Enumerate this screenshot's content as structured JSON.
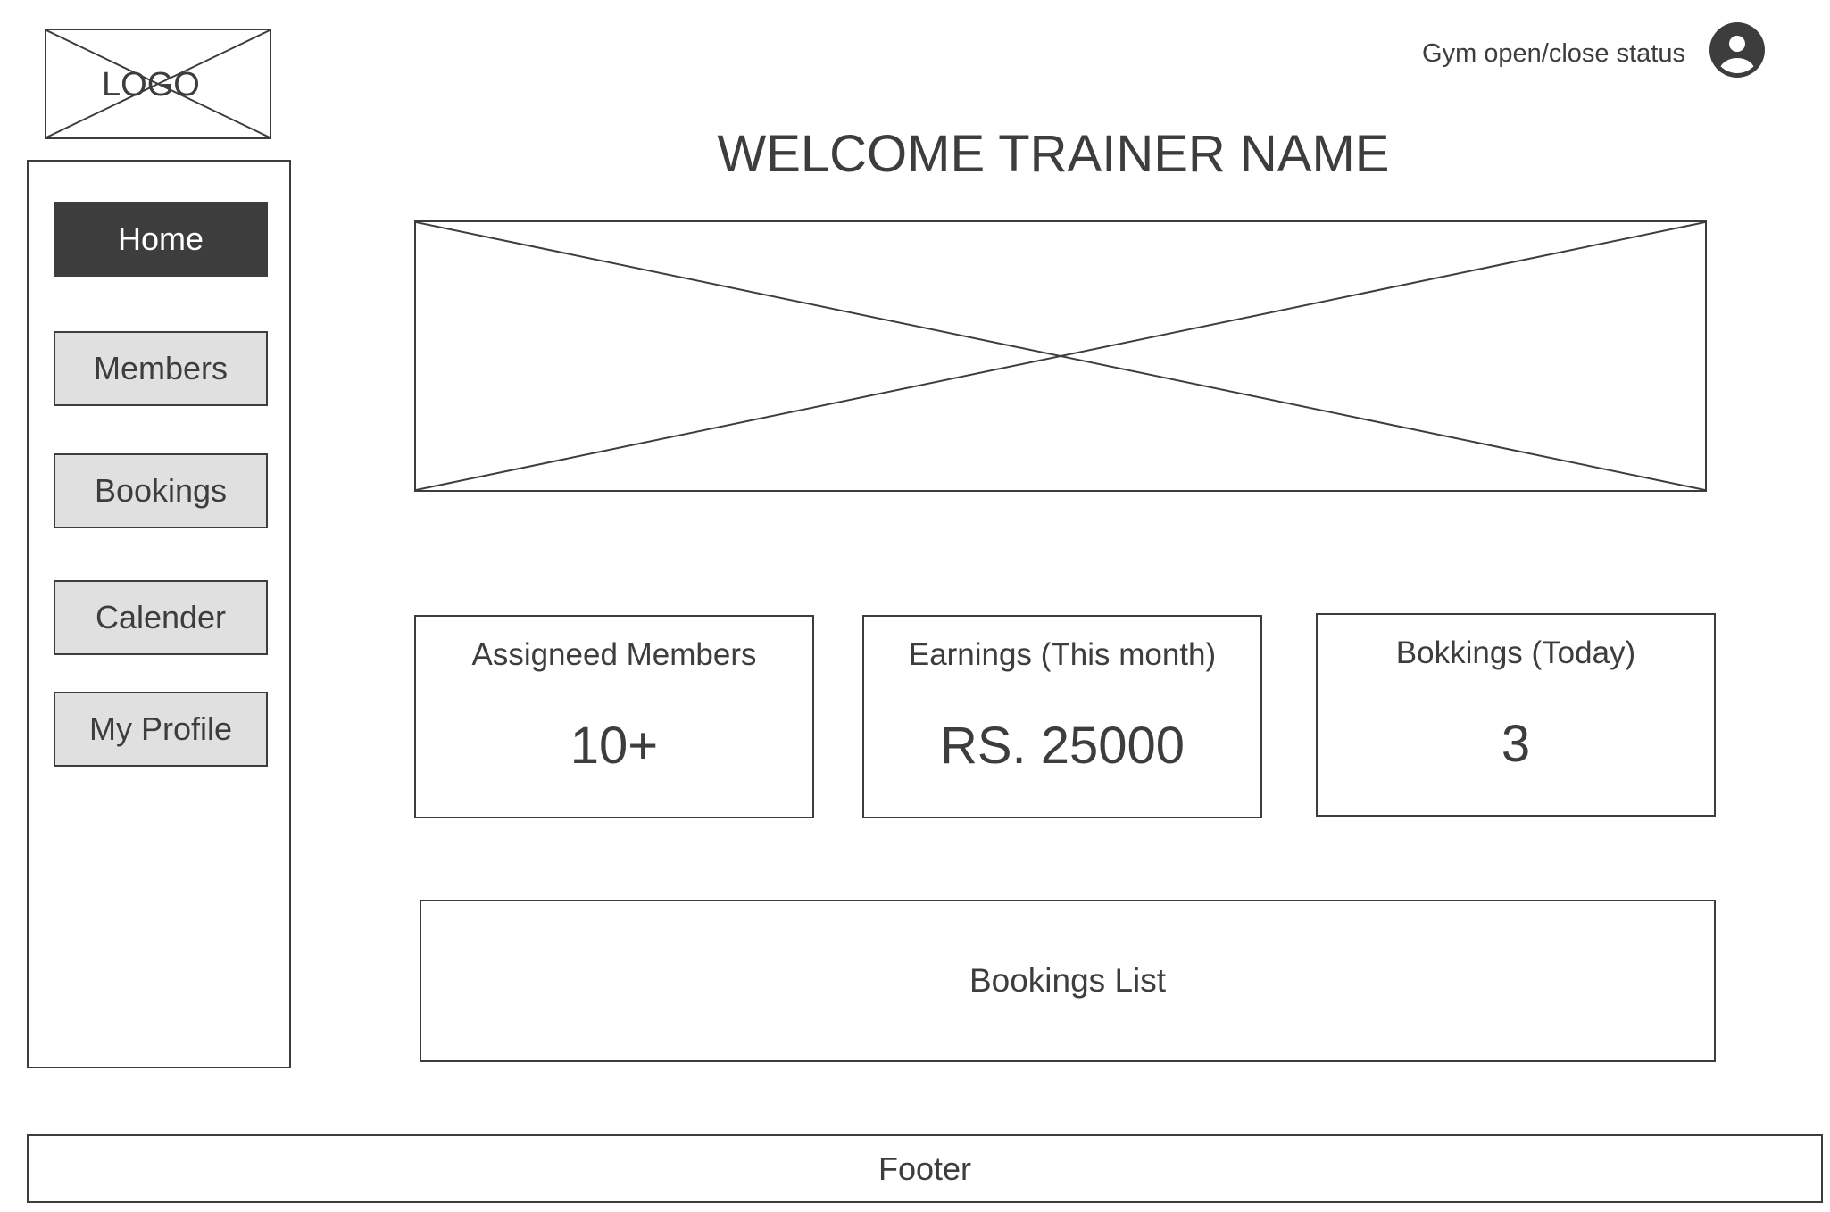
{
  "logo": {
    "text": "LOGO"
  },
  "header": {
    "gym_status": "Gym open/close status",
    "avatar_icon": "user-circle-icon",
    "title": "WELCOME TRAINER NAME"
  },
  "sidebar": {
    "items": [
      {
        "label": "Home",
        "active": true
      },
      {
        "label": "Members",
        "active": false
      },
      {
        "label": "Bookings",
        "active": false
      },
      {
        "label": "Calender",
        "active": false
      },
      {
        "label": "My Profile",
        "active": false
      }
    ]
  },
  "stats": [
    {
      "label": "Assigneed Members",
      "value": "10+"
    },
    {
      "label": "Earnings (This month)",
      "value": "RS. 25000"
    },
    {
      "label": "Bokkings (Today)",
      "value": "3"
    }
  ],
  "bookings_list": {
    "label": "Bookings List"
  },
  "footer": {
    "text": "Footer"
  },
  "colors": {
    "ink": "#3d3d3d",
    "button_bg": "#e0e0e0",
    "active_bg": "#3d3d3d",
    "active_text": "#ffffff"
  }
}
